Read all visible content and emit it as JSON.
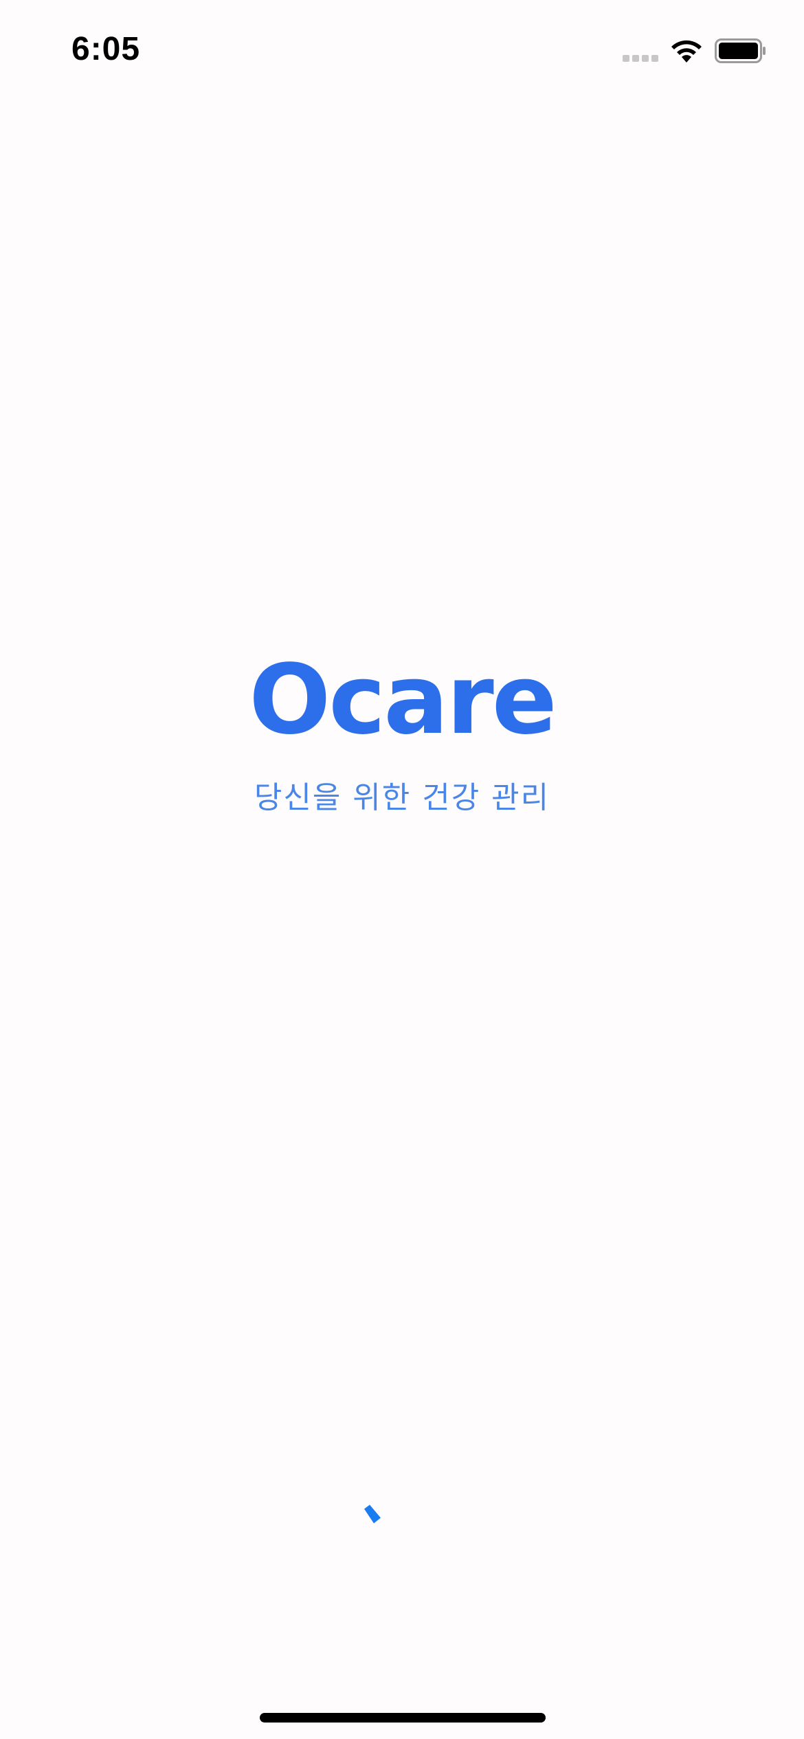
{
  "status_bar": {
    "time": "6:05",
    "icons": [
      "signal-icon",
      "wifi-icon",
      "battery-icon"
    ]
  },
  "splash": {
    "logo_text": "Ocare",
    "tagline": "당신을 위한 건강 관리"
  },
  "loading": {
    "icon": "loading-spinner-icon"
  },
  "colors": {
    "background": "#fffcfd",
    "brand_blue": "#2d6eea",
    "tagline_blue": "#4a86e8",
    "spinner_blue": "#1a7cf0"
  }
}
